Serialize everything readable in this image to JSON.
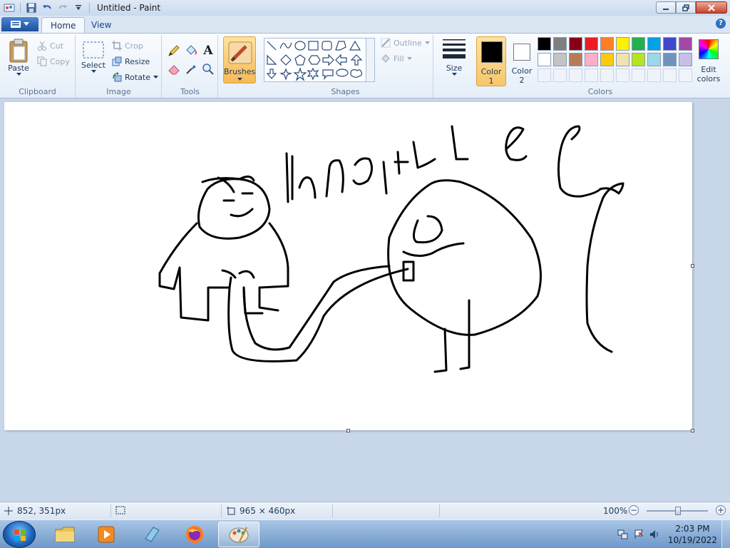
{
  "window": {
    "title": "Untitled - Paint"
  },
  "tabs": {
    "home": "Home",
    "view": "View"
  },
  "clipboard": {
    "paste": "Paste",
    "cut": "Cut",
    "copy": "Copy",
    "label": "Clipboard"
  },
  "image": {
    "select": "Select",
    "crop": "Crop",
    "resize": "Resize",
    "rotate": "Rotate",
    "label": "Image"
  },
  "tools": {
    "label": "Tools",
    "text_glyph": "A"
  },
  "brushes": {
    "label": "Brushes"
  },
  "shapes": {
    "outline": "Outline",
    "fill": "Fill",
    "label": "Shapes"
  },
  "size": {
    "label": "Size"
  },
  "colors": {
    "color1_label": "Color",
    "color1_num": "1",
    "color2_label": "Color",
    "color2_num": "2",
    "edit_label_1": "Edit",
    "edit_label_2": "colors",
    "label": "Colors",
    "color1_value": "#000000",
    "color2_value": "#ffffff",
    "palette_row1": [
      "#000000",
      "#7f7f7f",
      "#880015",
      "#ed1c24",
      "#ff7f27",
      "#fff200",
      "#22b14c",
      "#00a2e8",
      "#3f48cc",
      "#a349a4"
    ],
    "palette_row2": [
      "#ffffff",
      "#c3c3c3",
      "#b97a57",
      "#ffaec9",
      "#ffc90e",
      "#efe4b0",
      "#b5e61d",
      "#99d9ea",
      "#7092be",
      "#c8bfe7"
    ]
  },
  "status": {
    "cursor_pos": "852, 351px",
    "canvas_size": "965 × 460px",
    "zoom": "100%",
    "zoom_level": 100
  },
  "taskbar": {
    "time": "2:03 PM",
    "date": "10/19/2022"
  }
}
